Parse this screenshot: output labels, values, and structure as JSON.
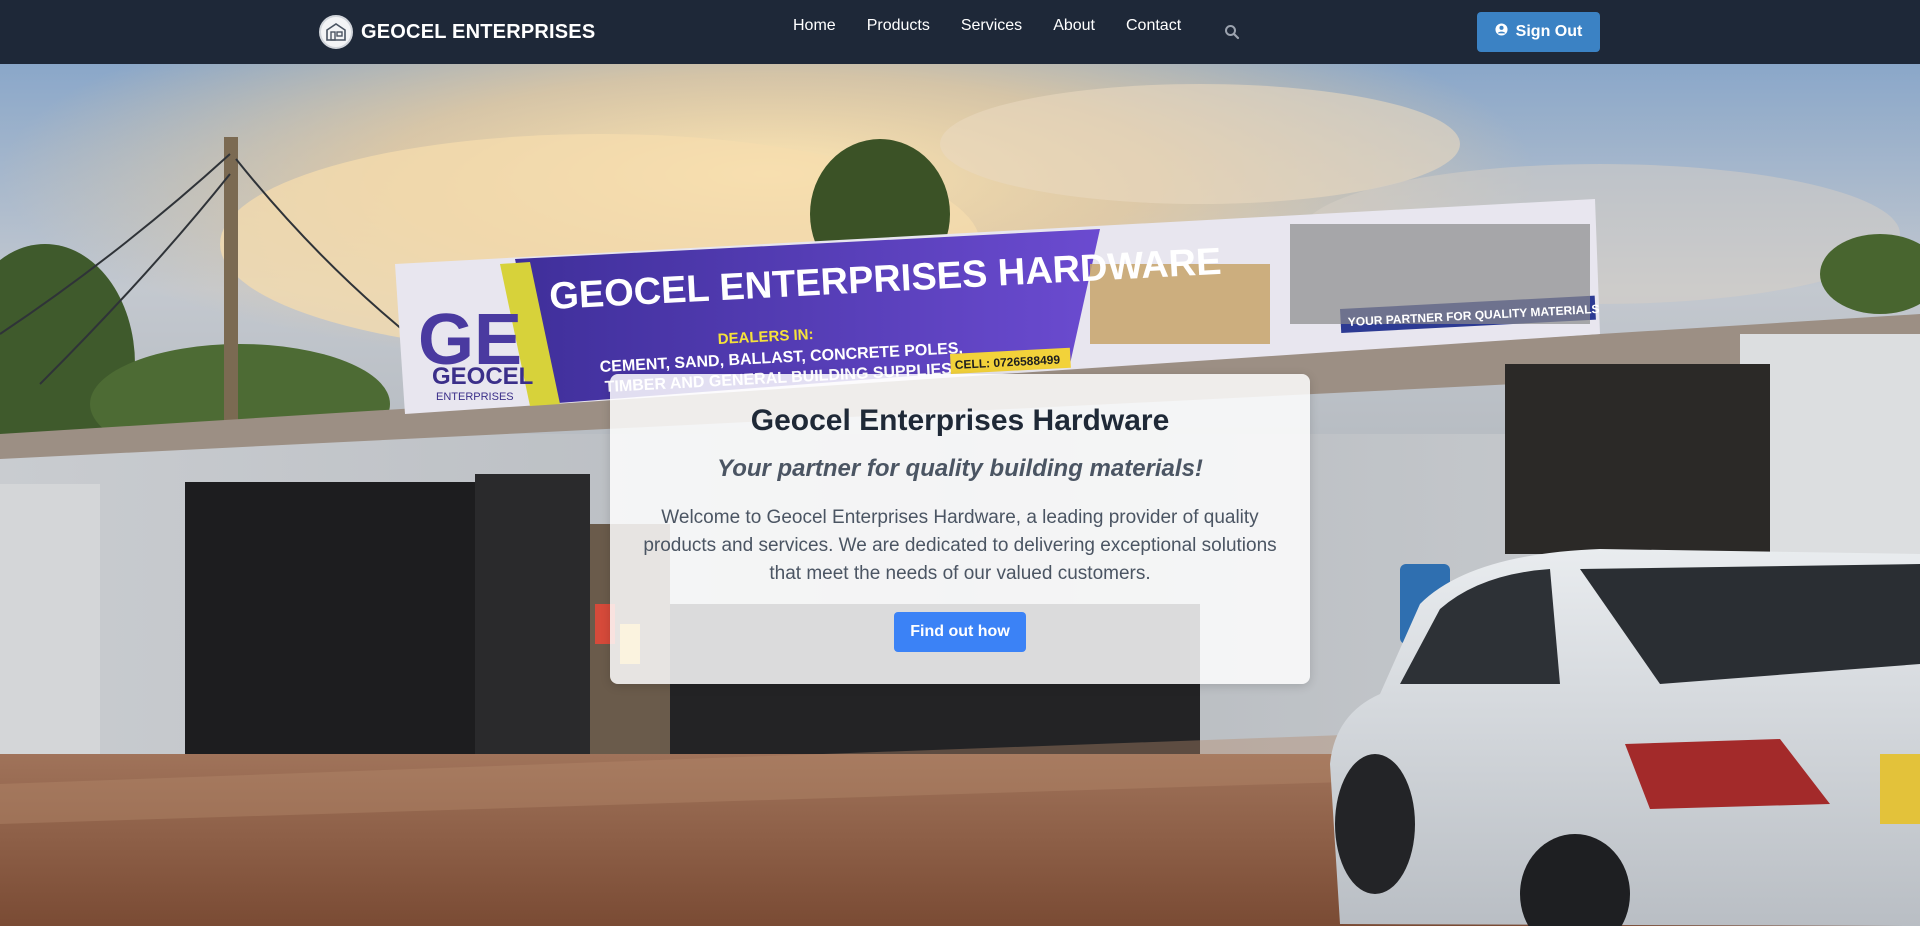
{
  "brand": {
    "name": "GEOCEL ENTERPRISES",
    "logo_icon": "storefront-logo-icon"
  },
  "nav": {
    "links": [
      "Home",
      "Products",
      "Services",
      "About",
      "Contact"
    ],
    "search_icon": "search-icon"
  },
  "account": {
    "signout_label": "Sign Out",
    "icon": "user-circle-icon"
  },
  "hero": {
    "title": "Geocel Enterprises Hardware",
    "subtitle": "Your partner for quality building materials!",
    "description": "Welcome to Geocel Enterprises Hardware, a leading provider of quality products and services. We are dedicated to delivering exceptional solutions that meet the needs of our valued customers.",
    "cta_label": "Find out how"
  },
  "signboard": {
    "logo_letters": "GE",
    "logo_name": "GEOCEL",
    "logo_sub": "ENTERPRISES",
    "headline": "GEOCEL ENTERPRISES HARDWARE",
    "dealers_label": "DEALERS IN:",
    "dealers_line1": "CEMENT, SAND, BALLAST, CONCRETE POLES,",
    "dealers_line2": "TIMBER AND GENERAL BUILDING SUPPLIES.",
    "cell": "CELL: 0726588499",
    "tagline": "YOUR PARTNER FOR QUALITY MATERIALS"
  },
  "colors": {
    "nav_bg": "#1e2838",
    "accent": "#3b82f6",
    "signout_bg": "#3b82c4"
  }
}
